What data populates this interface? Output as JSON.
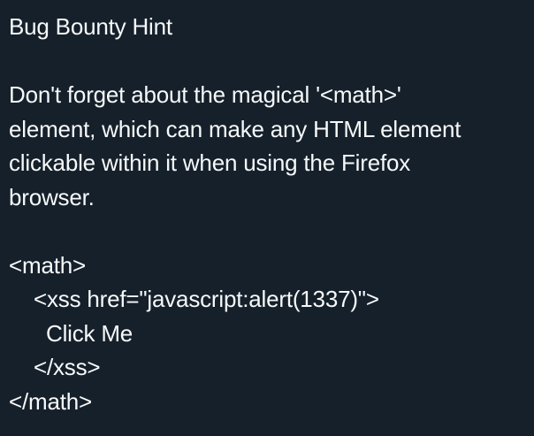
{
  "post": {
    "title": "Bug Bounty Hint",
    "body_lines": [
      "Don't forget about the magical '<math>'",
      "element, which can make any HTML element",
      "clickable within it when using the Firefox",
      "browser."
    ],
    "code_lines": [
      "<math>",
      "<xss href=\"javascript:alert(1337)\">",
      "Click Me",
      "</xss>",
      "</math>"
    ]
  },
  "colors": {
    "background": "#15202b",
    "text": "#f7f9f9"
  }
}
